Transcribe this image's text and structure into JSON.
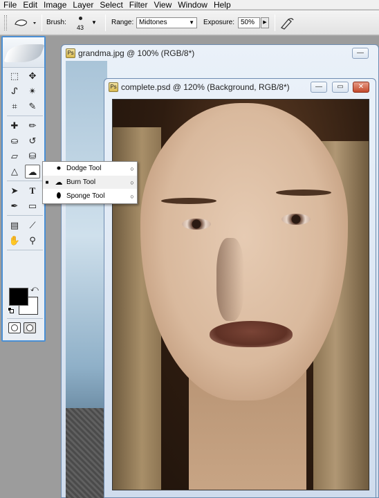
{
  "menu": [
    "File",
    "Edit",
    "Image",
    "Layer",
    "Select",
    "Filter",
    "View",
    "Window",
    "Help"
  ],
  "options": {
    "brush_label": "Brush:",
    "brush_size": "43",
    "range_label": "Range:",
    "range_value": "Midtones",
    "exposure_label": "Exposure:",
    "exposure_value": "50%"
  },
  "flyout": {
    "items": [
      {
        "label": "Dodge Tool",
        "key": "O",
        "selected": false
      },
      {
        "label": "Burn Tool",
        "key": "O",
        "selected": true
      },
      {
        "label": "Sponge Tool",
        "key": "O",
        "selected": false
      }
    ]
  },
  "windows": {
    "back_title": "grandma.jpg @ 100% (RGB/8*)",
    "front_title": "complete.psd @ 120% (Background, RGB/8*)"
  },
  "colors": {
    "accent": "#4a8fd4",
    "foreground": "#000000",
    "background": "#ffffff"
  },
  "icons": {
    "tools": [
      "marquee-icon",
      "move-icon",
      "lasso-icon",
      "magic-wand-icon",
      "crop-icon",
      "slice-icon",
      "healing-brush-icon",
      "brush-icon",
      "clone-stamp-icon",
      "history-brush-icon",
      "eraser-icon",
      "paint-bucket-icon",
      "blur-icon",
      "burn-icon",
      "path-selection-icon",
      "type-icon",
      "pen-icon",
      "shape-icon",
      "notes-icon",
      "eyedropper-icon",
      "hand-icon",
      "zoom-icon"
    ]
  }
}
